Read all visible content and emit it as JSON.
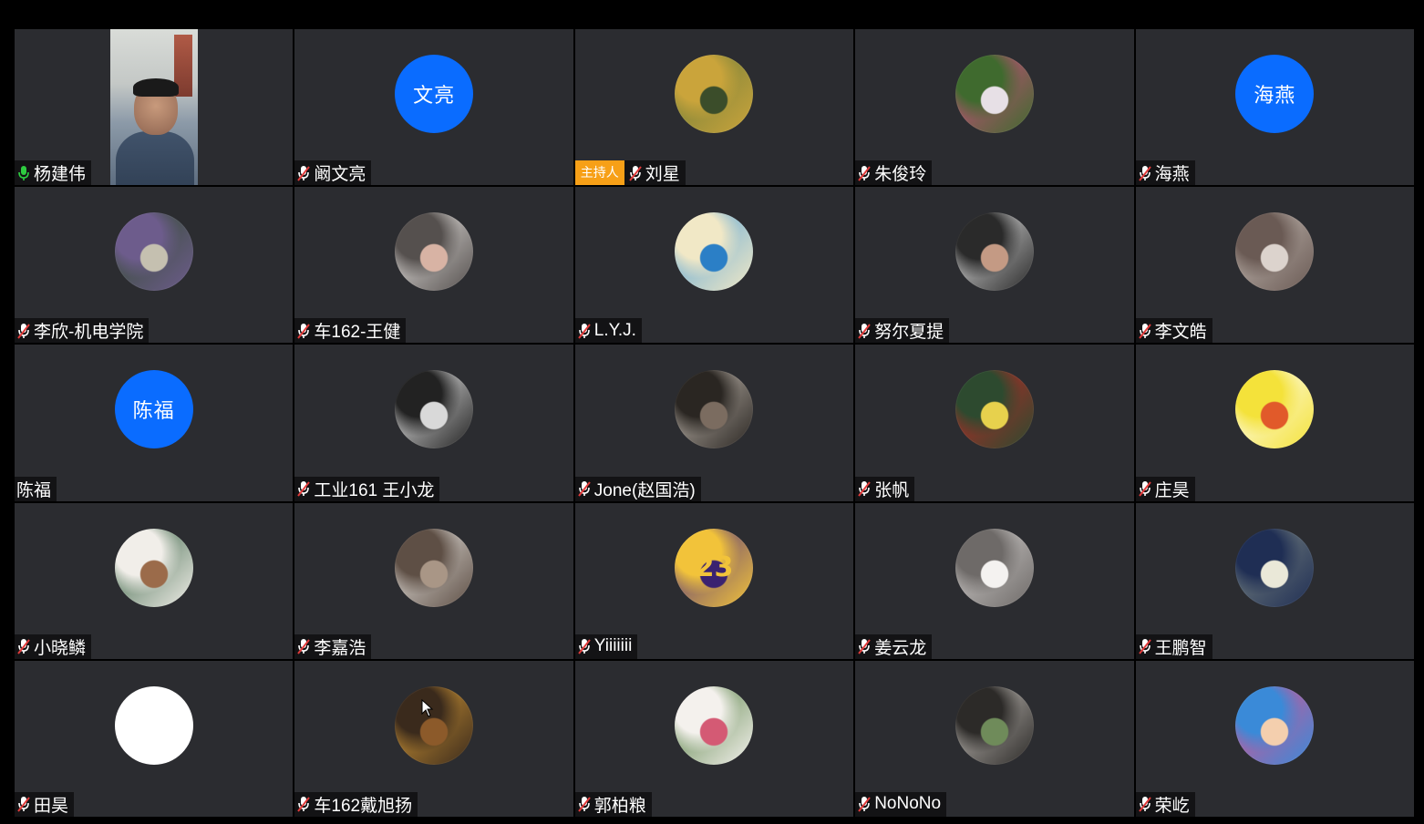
{
  "colors": {
    "background": "#000000",
    "tile": "#2b2c30",
    "avatar_initials_bg": "#0a6cff",
    "mic_muted": "#e23b3b",
    "mic_active": "#2ecc40",
    "host_tag_bg": "#f7a017"
  },
  "host_label": "主持人",
  "participants": [
    {
      "name": "杨建伟",
      "mic": "active",
      "kind": "video"
    },
    {
      "name": "阚文亮",
      "mic": "muted",
      "kind": "initials",
      "initials": "文亮"
    },
    {
      "name": "刘星",
      "mic": "muted",
      "kind": "photo",
      "host": true,
      "colors": [
        "#6b7b3a",
        "#caa43b",
        "#3b4d2a"
      ]
    },
    {
      "name": "朱俊玲",
      "mic": "muted",
      "kind": "photo",
      "colors": [
        "#d84a86",
        "#3f6a2e",
        "#e7e0e6"
      ]
    },
    {
      "name": "海燕",
      "mic": "muted",
      "kind": "initials",
      "initials": "海燕"
    },
    {
      "name": "李欣-机电学院",
      "mic": "muted",
      "kind": "photo",
      "colors": [
        "#2f4a2a",
        "#6d5c8c",
        "#c5c0b0"
      ]
    },
    {
      "name": "车162-王健",
      "mic": "muted",
      "kind": "photo",
      "colors": [
        "#f4f1ee",
        "#55504e",
        "#d8b3a4"
      ]
    },
    {
      "name": "L.Y.J.",
      "mic": "muted",
      "kind": "photo",
      "colors": [
        "#56a3d8",
        "#f1e8c6",
        "#2b7fc6"
      ]
    },
    {
      "name": "努尔夏提",
      "mic": "muted",
      "kind": "photo",
      "colors": [
        "#efefef",
        "#2a2a2a",
        "#c49a84"
      ]
    },
    {
      "name": "李文皓",
      "mic": "muted",
      "kind": "photo",
      "colors": [
        "#c8bfb8",
        "#6a5a54",
        "#dcd3cd"
      ]
    },
    {
      "name": "陈福",
      "mic": "none",
      "kind": "initials",
      "initials": "陈福"
    },
    {
      "name": "工业161 王小龙",
      "mic": "muted",
      "kind": "photo",
      "colors": [
        "#ffffff",
        "#222222",
        "#d9d9d9"
      ]
    },
    {
      "name": "Jone(赵国浩)",
      "mic": "muted",
      "kind": "photo",
      "colors": [
        "#cfc6bc",
        "#2a2622",
        "#7b6c60"
      ]
    },
    {
      "name": "张帆",
      "mic": "muted",
      "kind": "photo",
      "colors": [
        "#c52525",
        "#2d4a2f",
        "#e7d14d"
      ]
    },
    {
      "name": "庄昊",
      "mic": "muted",
      "kind": "photo",
      "colors": [
        "#ffffff",
        "#f4e23a",
        "#e15a2a"
      ]
    },
    {
      "name": "小晓鳞",
      "mic": "muted",
      "kind": "photo",
      "colors": [
        "#2e5a3a",
        "#f1eee9",
        "#9b6b4a"
      ]
    },
    {
      "name": "李嘉浩",
      "mic": "muted",
      "kind": "photo",
      "colors": [
        "#f2f0ec",
        "#5e4f45",
        "#a99686"
      ]
    },
    {
      "name": "Yiiiiiii",
      "mic": "muted",
      "kind": "photo",
      "colors": [
        "#4a2c83",
        "#f2c33a",
        "#3a2270"
      ],
      "text": "23"
    },
    {
      "name": "姜云龙",
      "mic": "muted",
      "kind": "photo",
      "colors": [
        "#d9d6d4",
        "#6e6a68",
        "#f4f2f0"
      ]
    },
    {
      "name": "王鹏智",
      "mic": "muted",
      "kind": "photo",
      "colors": [
        "#7f8a84",
        "#1f2e54",
        "#eae8d8"
      ]
    },
    {
      "name": "田昊",
      "mic": "muted",
      "kind": "blank"
    },
    {
      "name": "车162戴旭扬",
      "mic": "muted",
      "kind": "photo",
      "colors": [
        "#e0a238",
        "#3a2a1c",
        "#8c5a2a"
      ]
    },
    {
      "name": "郭柏粮",
      "mic": "muted",
      "kind": "photo",
      "colors": [
        "#4e7a3a",
        "#f4f1ed",
        "#d45a74"
      ]
    },
    {
      "name": "NoNoNo",
      "mic": "muted",
      "kind": "photo",
      "colors": [
        "#cfcac4",
        "#2c2a28",
        "#6f8b5a"
      ]
    },
    {
      "name": "荣屹",
      "mic": "muted",
      "kind": "photo",
      "colors": [
        "#e34f8b",
        "#3a8ad8",
        "#f4cfae"
      ]
    }
  ]
}
